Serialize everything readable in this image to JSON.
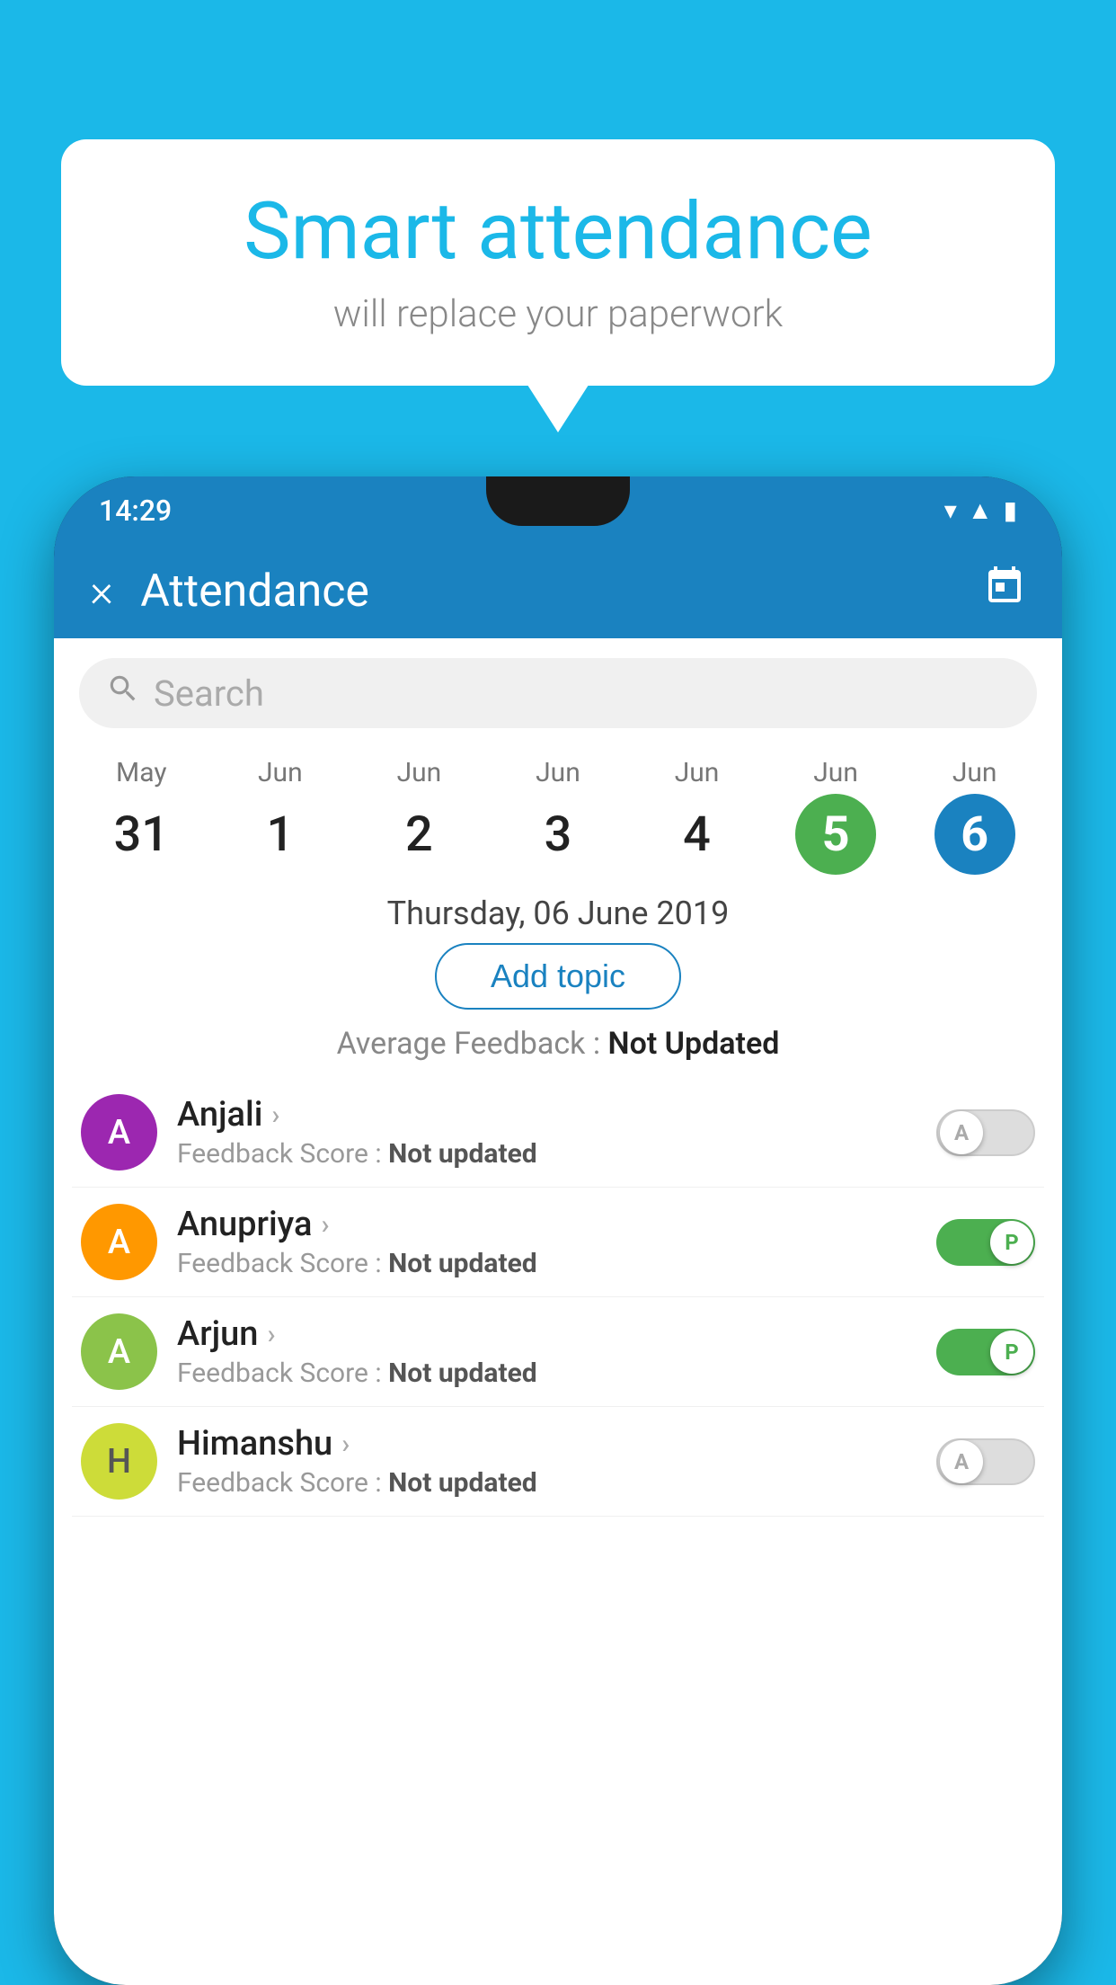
{
  "background_color": "#1bb8e8",
  "bubble": {
    "title": "Smart attendance",
    "subtitle": "will replace your paperwork"
  },
  "status_bar": {
    "time": "14:29"
  },
  "app_bar": {
    "title": "Attendance",
    "close_label": "×",
    "calendar_icon": "📅"
  },
  "search": {
    "placeholder": "Search"
  },
  "dates": [
    {
      "month": "May",
      "day": "31",
      "selected": false
    },
    {
      "month": "Jun",
      "day": "1",
      "selected": false
    },
    {
      "month": "Jun",
      "day": "2",
      "selected": false
    },
    {
      "month": "Jun",
      "day": "3",
      "selected": false
    },
    {
      "month": "Jun",
      "day": "4",
      "selected": false
    },
    {
      "month": "Jun",
      "day": "5",
      "selected": "green"
    },
    {
      "month": "Jun",
      "day": "6",
      "selected": "blue"
    }
  ],
  "selected_date_label": "Thursday, 06 June 2019",
  "add_topic_label": "Add topic",
  "avg_feedback_label": "Average Feedback :",
  "avg_feedback_value": "Not Updated",
  "students": [
    {
      "name": "Anjali",
      "avatar_letter": "A",
      "avatar_color": "purple",
      "feedback_label": "Feedback Score :",
      "feedback_value": "Not updated",
      "toggle_state": "off",
      "toggle_label": "A"
    },
    {
      "name": "Anupriya",
      "avatar_letter": "A",
      "avatar_color": "orange",
      "feedback_label": "Feedback Score :",
      "feedback_value": "Not updated",
      "toggle_state": "on",
      "toggle_label": "P"
    },
    {
      "name": "Arjun",
      "avatar_letter": "A",
      "avatar_color": "green",
      "feedback_label": "Feedback Score :",
      "feedback_value": "Not updated",
      "toggle_state": "on",
      "toggle_label": "P"
    },
    {
      "name": "Himanshu",
      "avatar_letter": "H",
      "avatar_color": "olive",
      "feedback_label": "Feedback Score :",
      "feedback_value": "Not updated",
      "toggle_state": "off",
      "toggle_label": "A"
    }
  ]
}
